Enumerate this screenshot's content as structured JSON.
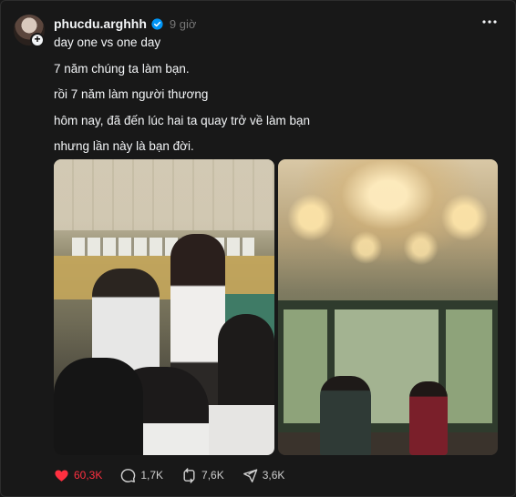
{
  "post": {
    "username": "phucdu.arghhh",
    "time": "9 giờ",
    "lines": [
      "day one vs one day",
      "7 năm chúng ta làm bạn.",
      "rồi 7 năm làm người thương",
      "hôm nay, đã đến lúc hai ta quay trở về làm bạn",
      "nhưng lần này là bạn đời."
    ],
    "avatar_plus": "+"
  },
  "actions": {
    "likes": "60,3K",
    "comments": "1,7K",
    "reposts": "7,6K",
    "shares": "3,6K"
  },
  "icons": {
    "verified": "verified-icon",
    "more": "more-icon",
    "like": "heart-icon",
    "comment": "comment-icon",
    "repost": "repost-icon",
    "share": "share-icon"
  },
  "colors": {
    "background": "#181818",
    "text": "#f3f5f7",
    "muted": "#777777",
    "like": "#ff3040",
    "verified": "#0095f6"
  }
}
